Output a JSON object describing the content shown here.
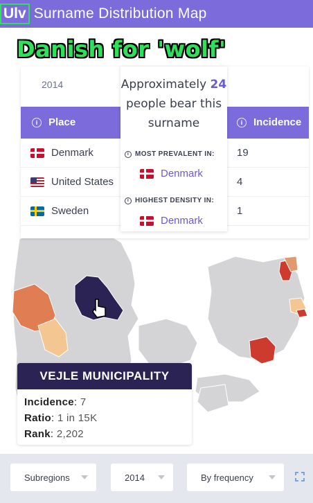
{
  "header": {
    "surname_badge": "Ulv",
    "title": "Surname Distribution Map"
  },
  "caption": "Danish for 'wolf'",
  "table": {
    "year": "2014",
    "col_place": "Place",
    "col_incidence": "Incidence",
    "rows": [
      {
        "place": "Denmark",
        "incidence": "19",
        "flag": "denmark-flag-icon"
      },
      {
        "place": "United States",
        "incidence": "4",
        "flag": "usa-flag-icon"
      },
      {
        "place": "Sweden",
        "incidence": "1",
        "flag": "sweden-flag-icon"
      }
    ]
  },
  "popup": {
    "approx_prefix": "Approximately",
    "count": "24",
    "approx_suffix": "people bear this surname",
    "most_prevalent_label": "MOST PREVALENT IN:",
    "most_prevalent_value": "Denmark",
    "highest_density_label": "HIGHEST DENSITY IN:",
    "highest_density_value": "Denmark"
  },
  "municipality": {
    "name": "VEJLE MUNICIPALITY",
    "incidence_label": "Incidence",
    "incidence_value": "7",
    "ratio_label": "Ratio",
    "ratio_value": "1 in 15K",
    "rank_label": "Rank",
    "rank_value": "2,202"
  },
  "controls": {
    "subregions": "Subregions",
    "year": "2014",
    "sort": "By frequency"
  },
  "colors": {
    "accent": "#7b6bdb",
    "dark": "#2a2354",
    "highlight": "#2fe05a",
    "heat_high": "#cc3b2e",
    "heat_mid": "#e07d52",
    "heat_low": "#f4c792"
  }
}
